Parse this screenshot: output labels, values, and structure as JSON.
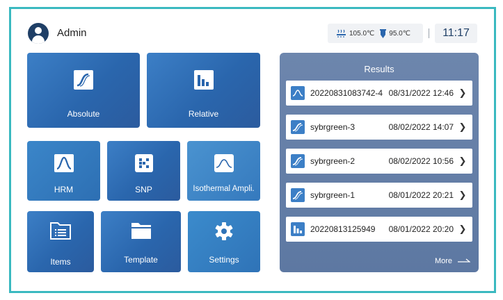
{
  "header": {
    "user_name": "Admin",
    "lid_temp": "105.0℃",
    "block_temp": "95.0℃",
    "time": "11:17"
  },
  "tiles": {
    "absolute": "Absolute",
    "relative": "Relative",
    "hrm": "HRM",
    "snp": "SNP",
    "isothermal": "Isothermal Ampli.",
    "items": "Items",
    "template": "Template",
    "settings": "Settings"
  },
  "results": {
    "title": "Results",
    "more_label": "More",
    "rows": [
      {
        "name": "20220831083742-4",
        "date": "08/31/2022 12:46",
        "icon": "melt-curve-icon"
      },
      {
        "name": "sybrgreen-3",
        "date": "08/02/2022 14:07",
        "icon": "amplification-curve-icon"
      },
      {
        "name": "sybrgreen-2",
        "date": "08/02/2022 10:56",
        "icon": "amplification-curve-icon"
      },
      {
        "name": "sybrgreen-1",
        "date": "08/01/2022 20:21",
        "icon": "amplification-curve-icon"
      },
      {
        "name": "20220813125949",
        "date": "08/01/2022 20:20",
        "icon": "bar-chart-icon"
      }
    ]
  },
  "colors": {
    "frame": "#3ab9c0",
    "tile": "#2a66ad",
    "panel": "#6581a8",
    "accent_text": "#1f3f66"
  }
}
